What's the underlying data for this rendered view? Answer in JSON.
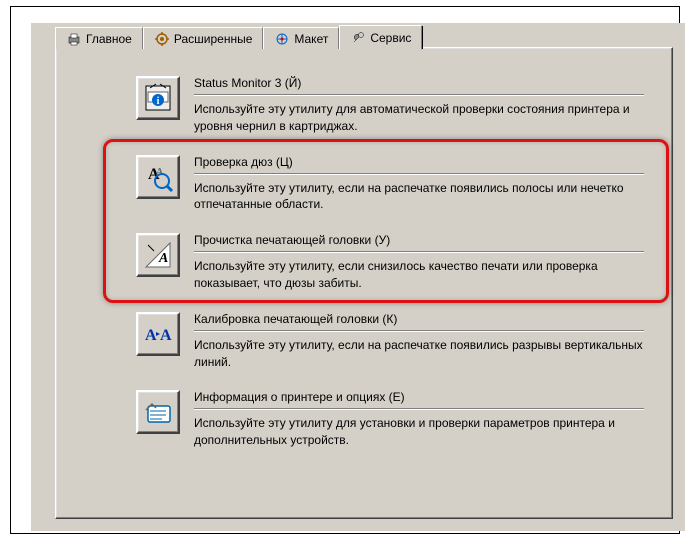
{
  "tabs": [
    {
      "label": "Главное",
      "icon": "printer-icon"
    },
    {
      "label": "Расширенные",
      "icon": "tools-icon"
    },
    {
      "label": "Макет",
      "icon": "layout-icon"
    },
    {
      "label": "Сервис",
      "icon": "wrench-icon"
    }
  ],
  "active_tab": "Сервис",
  "utilities": [
    {
      "id": "status-monitor",
      "title": "Status Monitor 3 (Й)",
      "desc": "Используйте эту утилиту для автоматической проверки состояния принтера и уровня чернил в картриджах.",
      "icon": "monitor-icon"
    },
    {
      "id": "nozzle-check",
      "title": "Проверка дюз (Ц)",
      "desc": "Используйте эту утилиту, если на распечатке появились полосы или нечетко отпечатанные области.",
      "icon": "nozzle-icon"
    },
    {
      "id": "head-cleaning",
      "title": "Прочистка печатающей головки (У)",
      "desc": "Используйте эту утилиту, если снизилось качество печати или проверка показывает, что дюзы забиты.",
      "icon": "cleaning-icon"
    },
    {
      "id": "head-alignment",
      "title": "Калибровка печатающей головки (К)",
      "desc": "Используйте эту утилиту, если на распечатке появились разрывы вертикальных линий.",
      "icon": "align-icon"
    },
    {
      "id": "printer-info",
      "title": "Информация о принтере и опциях (Е)",
      "desc": "Используйте эту утилиту для установки и проверки параметров принтера и дополнительных устройств.",
      "icon": "info-icon"
    }
  ]
}
